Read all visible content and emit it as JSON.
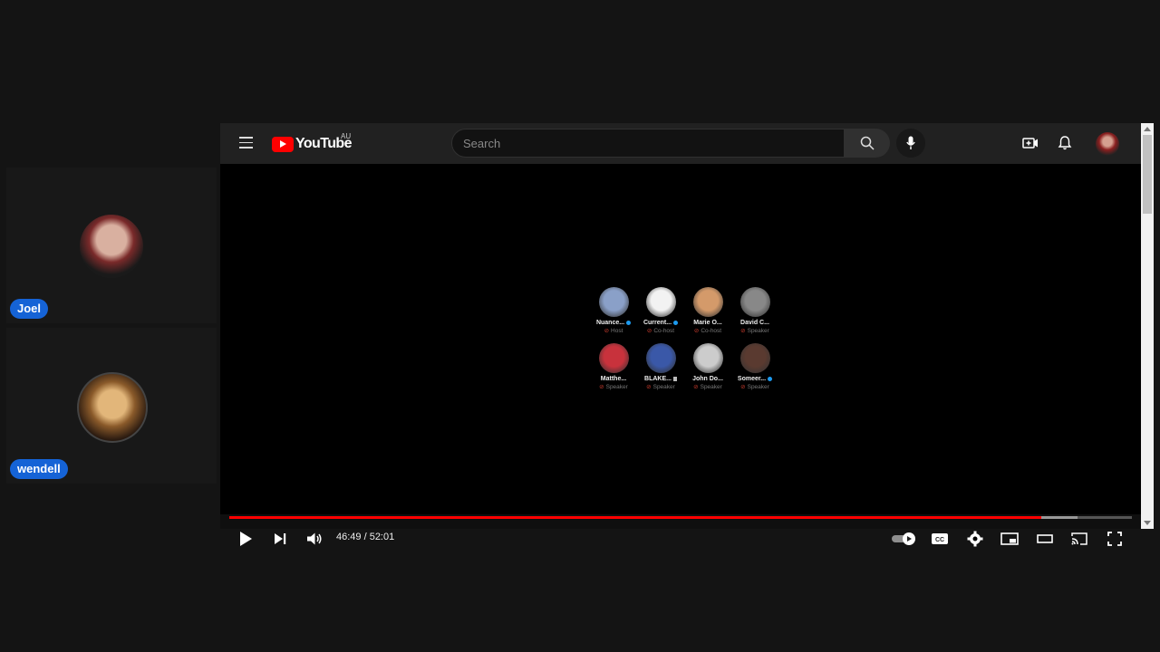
{
  "participants": [
    {
      "name": "Joel"
    },
    {
      "name": "wendell"
    }
  ],
  "youtube": {
    "logo_text": "YouTube",
    "region": "AU",
    "search_placeholder": "Search",
    "accent_color": "#ff0000"
  },
  "video": {
    "speakers": [
      {
        "name": "Nuance...",
        "role": "Host",
        "verified": true,
        "color": "#8aa0c8"
      },
      {
        "name": "Current...",
        "role": "Co-host",
        "verified": true,
        "color": "#f2f2f2"
      },
      {
        "name": "Marie O...",
        "role": "Co-host",
        "verified": false,
        "color": "#d49a6a"
      },
      {
        "name": "David C...",
        "role": "Speaker",
        "verified": false,
        "color": "#888888"
      },
      {
        "name": "Matthe...",
        "role": "Speaker",
        "verified": false,
        "color": "#c8323c"
      },
      {
        "name": "BLAKE...",
        "role": "Speaker",
        "verified": false,
        "locked": true,
        "color": "#3a58a8"
      },
      {
        "name": "John Do...",
        "role": "Speaker",
        "verified": false,
        "color": "#cccccc"
      },
      {
        "name": "Someer...",
        "role": "Speaker",
        "verified": true,
        "color": "#5a3a30"
      }
    ]
  },
  "player": {
    "time_display": "46:49 / 52:01",
    "played_fraction": 0.9001,
    "buffered_fraction": 0.94
  }
}
